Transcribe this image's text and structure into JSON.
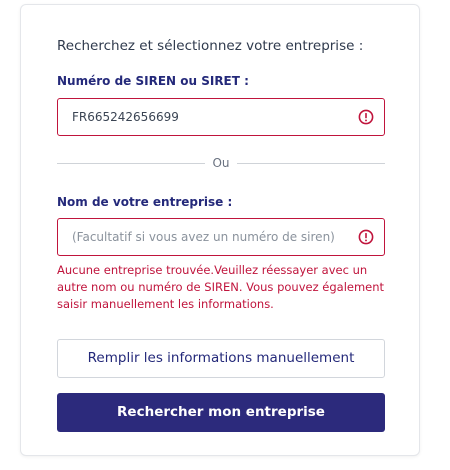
{
  "form": {
    "heading": "Recherchez et sélectionnez votre entreprise :",
    "siren": {
      "label": "Numéro de SIREN ou SIRET :",
      "value": "FR665242656699",
      "state": "error"
    },
    "separator": "Ou",
    "company_name": {
      "label": "Nom de votre entreprise :",
      "placeholder": "(Facultatif si vous avez un numéro de siren)",
      "value": "",
      "state": "error"
    },
    "error_message": "Aucune entreprise trouvée.Veuillez réessayer avec un autre nom ou numéro de SIREN. Vous pouvez également saisir manuellement les informations.",
    "manual_button_label": "Remplir les informations manuellement",
    "search_button_label": "Rechercher mon entreprise"
  },
  "icons": {
    "field_error": "error-circle-icon"
  },
  "colors": {
    "error": "#c0143c",
    "primary": "#2c2a7c",
    "label": "#24297a",
    "heading": "#2f3a4d"
  }
}
